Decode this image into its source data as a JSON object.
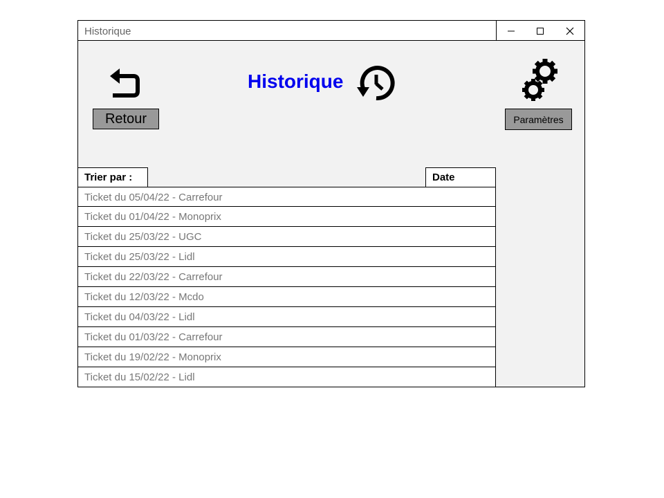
{
  "window": {
    "title": "Historique",
    "controls": [
      "minimize",
      "maximize",
      "close"
    ]
  },
  "header": {
    "back_label": "Retour",
    "page_title": "Historique",
    "settings_label": "Paramètres",
    "title_color": "#0000ee"
  },
  "sort": {
    "label": "Trier par :",
    "value": "Date"
  },
  "tickets": [
    "Ticket du 05/04/22 - Carrefour",
    "Ticket du 01/04/22 - Monoprix",
    "Ticket du 25/03/22 - UGC",
    "Ticket du 25/03/22 - Lidl",
    "Ticket du 22/03/22 - Carrefour",
    "Ticket du 12/03/22 - Mcdo",
    "Ticket du 04/03/22 - Lidl",
    "Ticket du 01/03/22 - Carrefour",
    "Ticket du 19/02/22 - Monoprix",
    "Ticket du 15/02/22 - Lidl"
  ]
}
